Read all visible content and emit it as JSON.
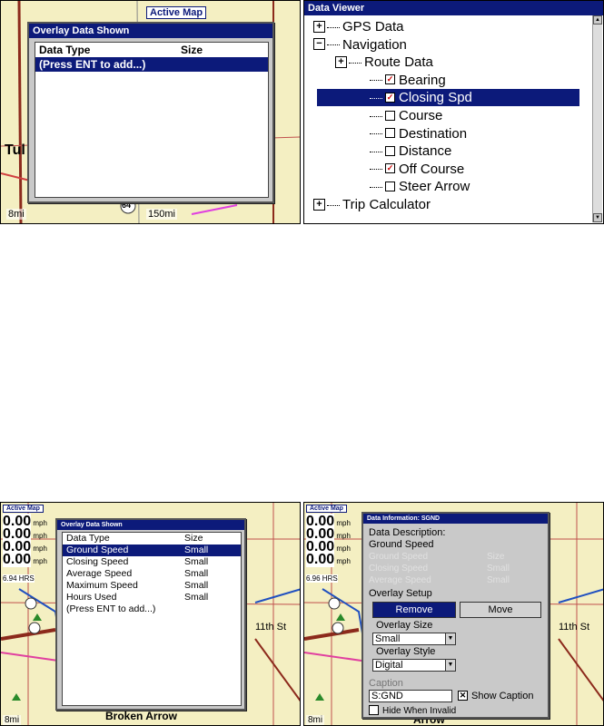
{
  "panel1": {
    "map_label": "Active Map",
    "scale_left": "8mi",
    "scale_right": "150mi",
    "city_fragment": "Tul",
    "road_marker": "64",
    "dialog": {
      "title": "Overlay Data Shown",
      "col_type": "Data Type",
      "col_size": "Size",
      "rows": [
        {
          "type": "(Press ENT to add...)",
          "size": ""
        }
      ]
    }
  },
  "panel2": {
    "title": "Data Viewer",
    "tree": [
      {
        "label": "GPS Data",
        "kind": "expander",
        "symbol": "+",
        "level": 0
      },
      {
        "label": "Navigation",
        "kind": "expander",
        "symbol": "−",
        "level": 0
      },
      {
        "label": "Route Data",
        "kind": "expander",
        "symbol": "+",
        "level": 1
      },
      {
        "label": "Bearing",
        "kind": "checkbox",
        "checked": true,
        "level": 2
      },
      {
        "label": "Closing Spd",
        "kind": "checkbox",
        "checked": true,
        "level": 2,
        "selected": true
      },
      {
        "label": "Course",
        "kind": "checkbox",
        "checked": false,
        "level": 2
      },
      {
        "label": "Destination",
        "kind": "checkbox",
        "checked": false,
        "level": 2
      },
      {
        "label": "Distance",
        "kind": "checkbox",
        "checked": false,
        "level": 2
      },
      {
        "label": "Off Course",
        "kind": "checkbox",
        "checked": true,
        "level": 2
      },
      {
        "label": "Steer Arrow",
        "kind": "checkbox",
        "checked": false,
        "level": 2
      },
      {
        "label": "Trip Calculator",
        "kind": "expander",
        "symbol": "+",
        "level": 0
      }
    ]
  },
  "panel3": {
    "map_label": "Active Map",
    "speeds": [
      {
        "value": "0.00",
        "unit": "mph"
      },
      {
        "value": "0.00",
        "unit": "mph"
      },
      {
        "value": "0.00",
        "unit": "mph"
      },
      {
        "value": "0.00",
        "unit": "mph"
      }
    ],
    "hours": "6.94 HRS",
    "scale": "8mi",
    "street": "11th St",
    "place": "Broken Arrow",
    "dialog": {
      "title": "Overlay Data Shown",
      "col_type": "Data Type",
      "col_size": "Size",
      "rows": [
        {
          "type": "Ground Speed",
          "size": "Small",
          "selected": true
        },
        {
          "type": "Closing Speed",
          "size": "Small"
        },
        {
          "type": "Average Speed",
          "size": "Small"
        },
        {
          "type": "Maximum Speed",
          "size": "Small"
        },
        {
          "type": "Hours Used",
          "size": "Small"
        },
        {
          "type": "(Press ENT to add...)",
          "size": ""
        }
      ]
    }
  },
  "panel4": {
    "map_label": "Active Map",
    "speeds": [
      {
        "value": "0.00",
        "unit": "mph"
      },
      {
        "value": "0.00",
        "unit": "mph"
      },
      {
        "value": "0.00",
        "unit": "mph"
      },
      {
        "value": "0.00",
        "unit": "mph"
      }
    ],
    "hours": "6.96 HRS",
    "scale": "8mi",
    "street": "11th St",
    "place": "Arrow",
    "dialog": {
      "title": "Data Information: SGND",
      "description_label": "Data Description:",
      "description_value": "Ground Speed",
      "ghost_rows": [
        {
          "type": "Ground Speed",
          "size": "Size"
        },
        {
          "type": "Closing Speed",
          "size": "Small"
        },
        {
          "type": "Average Speed",
          "size": "Small"
        }
      ],
      "overlay_setup": "Overlay Setup",
      "remove": "Remove",
      "move": "Move",
      "overlay_size_label": "Overlay Size",
      "overlay_size_value": "Small",
      "overlay_style_label": "Overlay Style",
      "overlay_style_value": "Digital",
      "caption_label": "Caption",
      "caption_value": "S:GND",
      "show_caption": "Show Caption",
      "show_caption_checked": true,
      "hide_when_invalid": "Hide When Invalid",
      "hide_when_invalid_checked": false
    }
  }
}
